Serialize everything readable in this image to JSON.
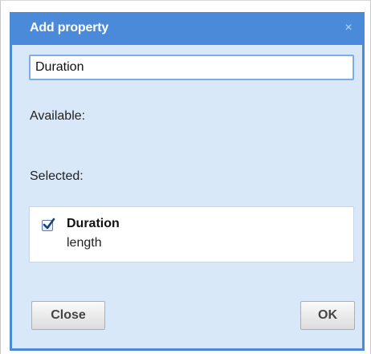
{
  "dialog": {
    "title": "Add property",
    "close_glyph": "×",
    "name_input": {
      "value": "Duration"
    },
    "available_label": "Available:",
    "selected_label": "Selected:",
    "selected_items": [
      {
        "name": "Duration",
        "type": "length",
        "checked": true
      }
    ],
    "buttons": {
      "close_label": "Close",
      "ok_label": "OK"
    }
  },
  "colors": {
    "titlebar": "#4a8ad8",
    "body": "#d8e8f8",
    "check": "#1a3f7a"
  }
}
